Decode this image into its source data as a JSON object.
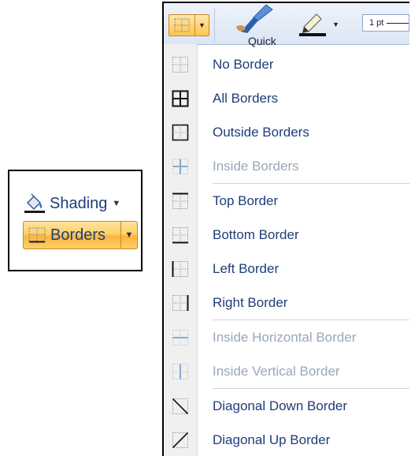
{
  "callout": {
    "shading_label": "Shading",
    "borders_label": "Borders"
  },
  "ribbon": {
    "cut_label": "Quick",
    "weight_value": "1 pt"
  },
  "menu": {
    "items": [
      {
        "label": "No Border",
        "icon": "no-border-icon",
        "enabled": true
      },
      {
        "label": "All Borders",
        "icon": "all-borders-icon",
        "enabled": true
      },
      {
        "label": "Outside Borders",
        "icon": "outside-borders-icon",
        "enabled": true
      },
      {
        "label": "Inside Borders",
        "icon": "inside-borders-icon",
        "enabled": false
      },
      {
        "label": "Top Border",
        "icon": "top-border-icon",
        "enabled": true
      },
      {
        "label": "Bottom Border",
        "icon": "bottom-border-icon",
        "enabled": true
      },
      {
        "label": "Left Border",
        "icon": "left-border-icon",
        "enabled": true
      },
      {
        "label": "Right Border",
        "icon": "right-border-icon",
        "enabled": true
      },
      {
        "label": "Inside Horizontal Border",
        "icon": "inside-horizontal-border-icon",
        "enabled": false
      },
      {
        "label": "Inside Vertical Border",
        "icon": "inside-vertical-border-icon",
        "enabled": false
      },
      {
        "label": "Diagonal Down Border",
        "icon": "diagonal-down-border-icon",
        "enabled": true
      },
      {
        "label": "Diagonal Up Border",
        "icon": "diagonal-up-border-icon",
        "enabled": true
      }
    ]
  },
  "colors": {
    "label": "#1f3d78",
    "disabled_label": "#9aa7b6",
    "highlight_orange": "#ffc44f"
  }
}
